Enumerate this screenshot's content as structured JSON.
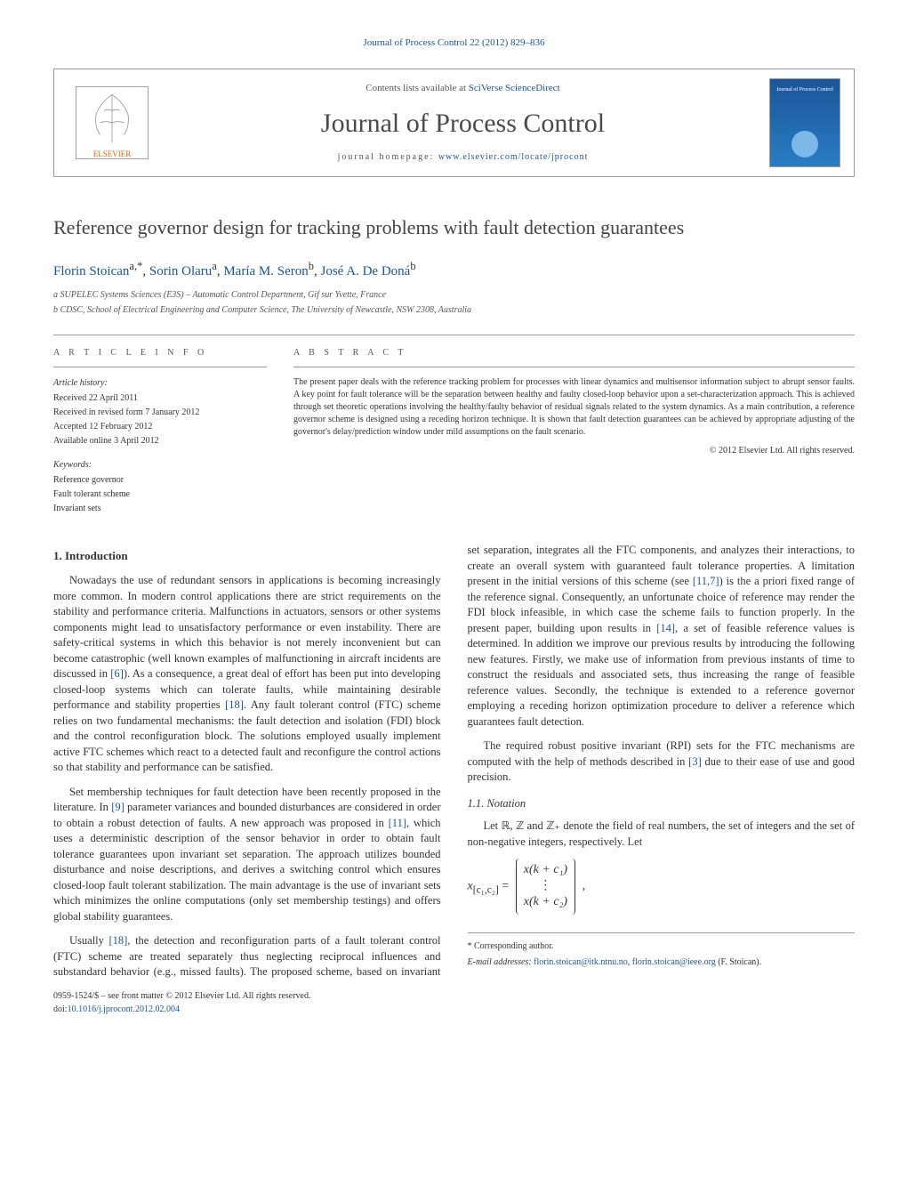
{
  "journal_ref": {
    "text": "Journal of Process Control 22 (2012) 829–836",
    "link_text": "Journal of Process Control 22 (2012) 829–836"
  },
  "header": {
    "contents_text": "Contents lists available at ",
    "contents_link": "SciVerse ScienceDirect",
    "journal_title": "Journal of Process Control",
    "homepage_label": "journal homepage: ",
    "homepage_url": "www.elsevier.com/locate/jprocont",
    "cover_small_text": "Journal of Process Control"
  },
  "article": {
    "title": "Reference governor design for tracking problems with fault detection guarantees",
    "authors_html": [
      {
        "name": "Florin Stoican",
        "sup": "a,*"
      },
      {
        "name": "Sorin Olaru",
        "sup": "a"
      },
      {
        "name": "María M. Seron",
        "sup": "b"
      },
      {
        "name": "José A. De Doná",
        "sup": "b"
      }
    ],
    "affiliations": [
      "a SUPELEC Systems Sciences (E3S) – Automatic Control Department, Gif sur Yvette, France",
      "b CDSC, School of Electrical Engineering and Computer Science, The University of Newcastle, NSW 2308, Australia"
    ]
  },
  "info": {
    "heading": "A R T I C L E   I N F O",
    "history_label": "Article history:",
    "history": [
      "Received 22 April 2011",
      "Received in revised form 7 January 2012",
      "Accepted 12 February 2012",
      "Available online 3 April 2012"
    ],
    "keywords_label": "Keywords:",
    "keywords": [
      "Reference governor",
      "Fault tolerant scheme",
      "Invariant sets"
    ]
  },
  "abstract": {
    "heading": "A B S T R A C T",
    "text": "The present paper deals with the reference tracking problem for processes with linear dynamics and multisensor information subject to abrupt sensor faults. A key point for fault tolerance will be the separation between healthy and faulty closed-loop behavior upon a set-characterization approach. This is achieved through set theoretic operations involving the healthy/faulty behavior of residual signals related to the system dynamics. As a main contribution, a reference governor scheme is designed using a receding horizon technique. It is shown that fault detection guarantees can be achieved by appropriate adjusting of the governor's delay/prediction window under mild assumptions on the fault scenario.",
    "copyright": "© 2012 Elsevier Ltd. All rights reserved."
  },
  "sections": {
    "intro_heading": "1.  Introduction",
    "intro_p1": "Nowadays the use of redundant sensors in applications is becoming increasingly more common. In modern control applications there are strict requirements on the stability and performance criteria. Malfunctions in actuators, sensors or other systems components might lead to unsatisfactory performance or even instability. There are safety-critical systems in which this behavior is not merely inconvenient but can become catastrophic (well known examples of malfunctioning in aircraft incidents are discussed in ",
    "ref6": "[6]",
    "intro_p1b": "). As a consequence, a great deal of effort has been put into developing closed-loop systems which can tolerate faults, while maintaining desirable performance and stability properties ",
    "ref18a": "[18]",
    "intro_p1c": ". Any fault tolerant control (FTC) scheme relies on two fundamental mechanisms: the fault detection and isolation (FDI) block and the control reconfiguration block. The solutions employed usually implement active FTC schemes which react to a detected fault and reconfigure the control actions so that stability and performance can be satisfied.",
    "intro_p2a": "Set membership techniques for fault detection have been recently proposed in the literature. In ",
    "ref9": "[9]",
    "intro_p2b": " parameter variances and bounded disturbances are considered in order to obtain a robust detection of faults. A new approach was proposed in ",
    "ref11a": "[11]",
    "intro_p2c": ", which uses a deterministic description of the sensor behavior in order to obtain fault tolerance guarantees upon invariant set separation. The approach utilizes bounded disturbance and noise descriptions, and derives a switching control which ensures closed-loop fault tolerant stabilization. The main advantage is the use of invariant sets ",
    "intro_p2d": "which minimizes the online computations (only set membership testings) and offers global stability guarantees.",
    "intro_p3a": "Usually ",
    "ref18b": "[18]",
    "intro_p3b": ", the detection and reconfiguration parts of a fault tolerant control (FTC) scheme are treated separately thus neglecting reciprocal influences and substandard behavior (e.g., missed faults). The proposed scheme, based on invariant set separation, integrates all the FTC components, and analyzes their interactions, to create an overall system with guaranteed fault tolerance properties. A limitation present in the initial versions of this scheme (see ",
    "ref117": "[11,7]",
    "intro_p3c": ") is the a priori fixed range of the reference signal. Consequently, an unfortunate choice of reference may render the FDI block infeasible, in which case the scheme fails to function properly. In the present paper, building upon results in ",
    "ref14": "[14]",
    "intro_p3d": ", a set of feasible reference values is determined. In addition we improve our previous results by introducing the following new features. Firstly, we make use of information from previous instants of time to construct the residuals and associated sets, thus increasing the range of feasible reference values. Secondly, the technique is extended to a reference governor employing a receding horizon optimization procedure to deliver a reference which guarantees fault detection.",
    "intro_p4a": "The required robust positive invariant (RPI) sets for the FTC mechanisms are computed with the help of methods described in ",
    "ref3": "[3]",
    "intro_p4b": " due to their ease of use and good precision.",
    "notation_heading": "1.1. Notation",
    "notation_p1": "Let ℝ, ℤ and ℤ₊ denote the field of real numbers, the set of integers and the set of non-negative integers, respectively. Let",
    "equation_lhs": "x",
    "equation_sub": "[c₁,c₂]",
    "equation_eq": " = ",
    "matrix_r1": "x(k + c₁)",
    "matrix_r2": "⋮",
    "matrix_r3": "x(k + c₂)",
    "equation_comma": ","
  },
  "footer": {
    "corresponding_marker": "*",
    "corresponding_text": " Corresponding author.",
    "email_label": "E-mail addresses: ",
    "email1": "florin.stoican@itk.ntnu.no",
    "email_sep": ", ",
    "email2": "florin.stoican@ieee.org",
    "email_author": " (F. Stoican).",
    "issn_line": "0959-1524/$ – see front matter © 2012 Elsevier Ltd. All rights reserved.",
    "doi_label": "doi:",
    "doi": "10.1016/j.jprocont.2012.02.004"
  }
}
